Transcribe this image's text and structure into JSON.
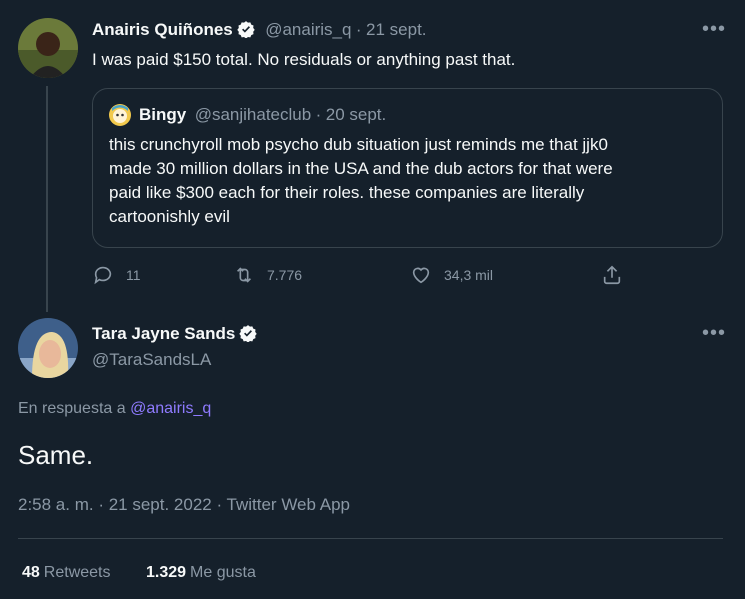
{
  "tweet1": {
    "name": "Anairis Quiñones",
    "handle": "@anairis_q",
    "separator": "·",
    "date": "21 sept.",
    "text": "I was paid $150 total. No residuals or anything past that.",
    "more": "•••",
    "quote": {
      "name": "Bingy",
      "handle": "@sanjihateclub",
      "separator": "·",
      "date": "20 sept.",
      "lines": [
        "this crunchyroll mob psycho dub situation just reminds me that jjk0",
        "made 30 million dollars in the USA and the dub actors for that were",
        "paid like $300 each for their roles. these companies are literally",
        "cartoonishly evil"
      ]
    },
    "actions": {
      "replies": "11",
      "retweets": "7.776",
      "likes": "34,3 mil"
    }
  },
  "tweet2": {
    "name": "Tara Jayne Sands",
    "handle": "@TaraSandsLA",
    "more": "•••",
    "reply_prefix": "En respuesta a",
    "reply_to": "@anairis_q",
    "text": "Same.",
    "meta": "2:58 a. m. · 21 sept. 2022 · Twitter Web App",
    "stats": {
      "retweets_count": "48",
      "retweets_label": "Retweets",
      "likes_count": "1.329",
      "likes_label": "Me gusta"
    }
  },
  "colors": {
    "background": "#15202b",
    "text": "#f7f9f9",
    "secondary": "#8b98a5",
    "border": "#38444d",
    "link": "#8f7bff"
  },
  "icons": [
    "verified-badge-icon",
    "reply-icon",
    "retweet-icon",
    "like-icon",
    "share-icon",
    "more-icon"
  ]
}
